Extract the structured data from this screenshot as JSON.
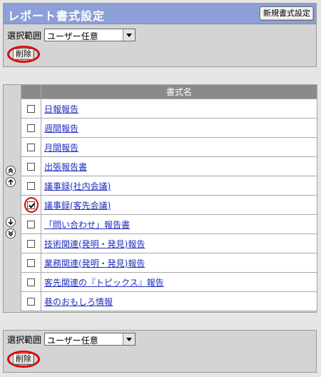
{
  "header": {
    "title": "レポート書式設定",
    "new_button_label": "新規書式設定"
  },
  "top_controls": {
    "range_label": "選択範囲",
    "range_value": "ユーザー任意",
    "delete_label": "削除"
  },
  "table": {
    "column_header": "書式名",
    "rows": [
      {
        "name": "日報報告",
        "checked": false
      },
      {
        "name": "週間報告",
        "checked": false
      },
      {
        "name": "月間報告",
        "checked": false
      },
      {
        "name": "出張報告書",
        "checked": false
      },
      {
        "name": "議事録(社内会議)",
        "checked": false
      },
      {
        "name": "議事録(客先会議)",
        "checked": true
      },
      {
        "name": "「問い合わせ」報告書",
        "checked": false
      },
      {
        "name": "技術関連(発明・発見)報告",
        "checked": false
      },
      {
        "name": "業務関連(発明・発見)報告",
        "checked": false
      },
      {
        "name": "客先関連の『トピックス』報告",
        "checked": false
      },
      {
        "name": "巷のおもしろ情報",
        "checked": false
      }
    ]
  },
  "side_icons": [
    "move-to-top-icon",
    "move-up-icon",
    "move-down-icon",
    "move-to-bottom-icon"
  ],
  "bottom_controls": {
    "range_label": "選択範囲",
    "range_value": "ユーザー任意",
    "delete_label": "削除"
  },
  "colors": {
    "title_bar": "#8c9fd6",
    "highlight": "#e00000",
    "link": "#1f2fbf"
  }
}
